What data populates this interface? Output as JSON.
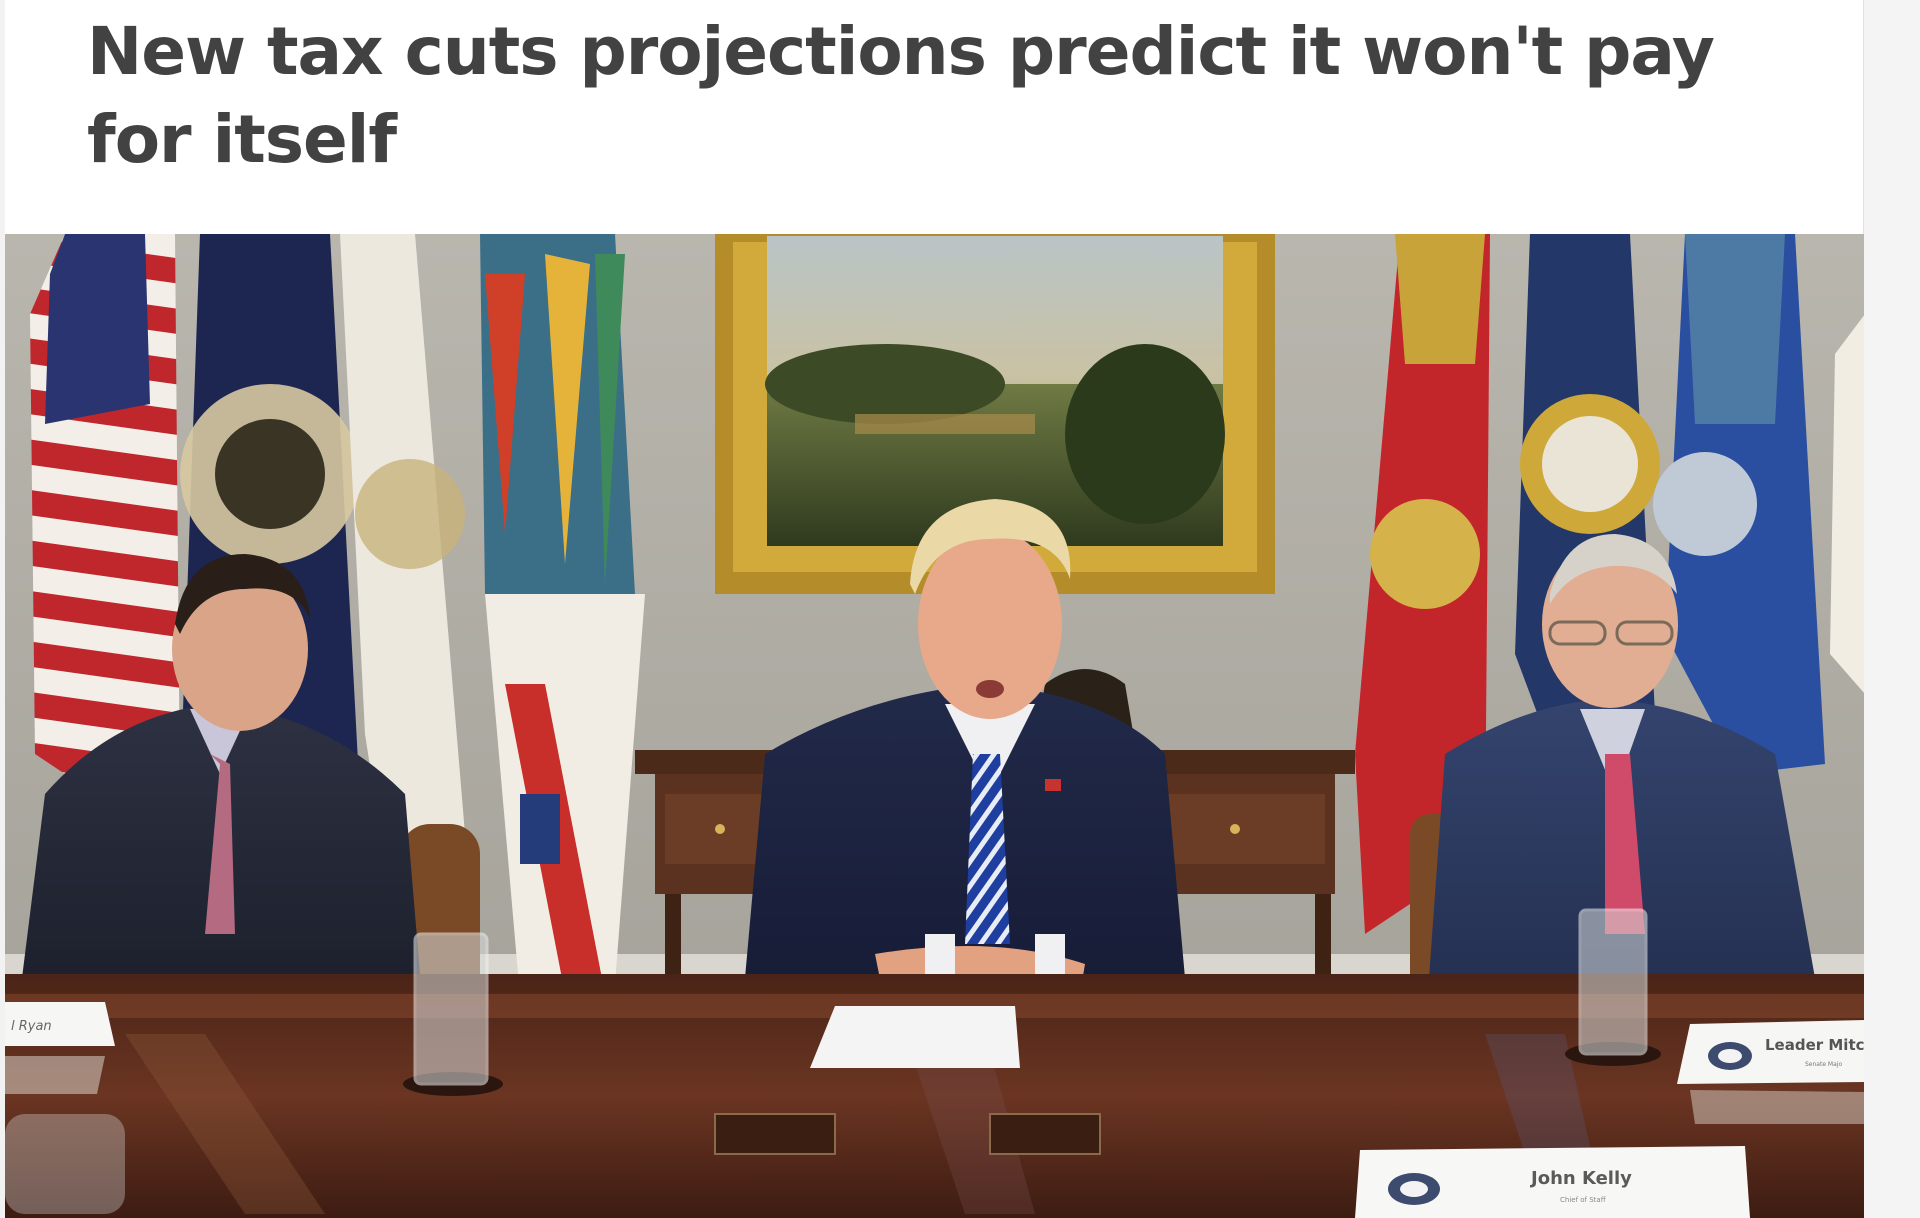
{
  "article": {
    "headline": "New tax cuts projections predict it won't pay for itself"
  },
  "photo": {
    "placards": {
      "left": "l Ryan",
      "right": "Leader Mitch",
      "center": "John Kelly",
      "center_sub": "Chief of Staff",
      "right_sub": "Senate Majo"
    }
  },
  "colors": {
    "headline": "#424242",
    "background": "#ffffff"
  }
}
